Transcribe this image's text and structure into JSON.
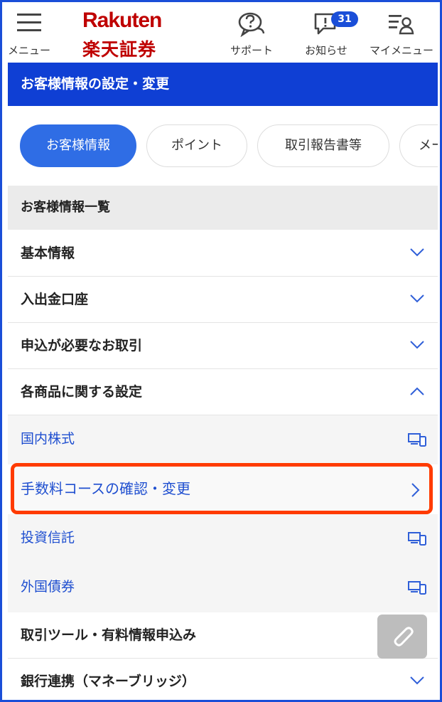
{
  "header": {
    "menu_label": "メニュー",
    "logo_en": "Rakuten",
    "logo_jp": "楽天証券",
    "support_label": "サポート",
    "notice_label": "お知らせ",
    "notice_badge": "31",
    "mymenu_label": "マイメニュー"
  },
  "title_bar": "お客様情報の設定・変更",
  "tabs": [
    {
      "label": "お客様情報",
      "active": true
    },
    {
      "label": "ポイント",
      "active": false
    },
    {
      "label": "取引報告書等",
      "active": false
    },
    {
      "label": "メー",
      "active": false
    }
  ],
  "section_title": "お客様情報一覧",
  "rows": {
    "basic": "基本情報",
    "bank": "入出金口座",
    "apply": "申込が必要なお取引",
    "product_settings": "各商品に関する設定",
    "tools": "取引ツール・有料情報申込み",
    "money_bridge": "銀行連携（マネーブリッジ）"
  },
  "sub_items": {
    "domestic_stock": "国内株式",
    "fee_course": "手数料コースの確認・変更",
    "investment_trust": "投資信託",
    "foreign_bond": "外国債券"
  },
  "colors": {
    "brand_red": "#bf0000",
    "primary_blue": "#0f3fd4",
    "link_blue": "#1f4fd0",
    "highlight": "#ff3b00"
  }
}
